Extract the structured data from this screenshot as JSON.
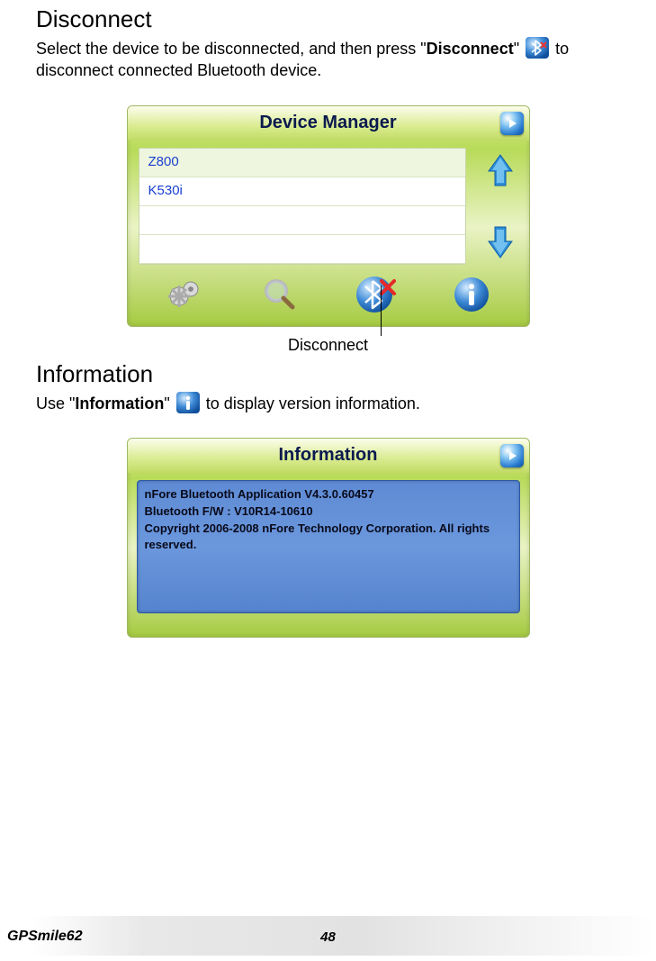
{
  "section_disconnect": {
    "heading": "Disconnect",
    "text_pre": "Select the device to be disconnected, and then press \"",
    "text_bold": "Disconnect",
    "text_mid": "\" ",
    "text_post": " to disconnect connected Bluetooth device."
  },
  "device_manager": {
    "title": "Device Manager",
    "devices": [
      "Z800",
      "K530i",
      "",
      ""
    ]
  },
  "disconnect_callout": "Disconnect",
  "section_info": {
    "heading": "Information",
    "text_pre": "Use \"",
    "text_bold": "Information",
    "text_mid": "\" ",
    "text_post": " to display version information."
  },
  "information_panel": {
    "title": "Information",
    "line1": "nFore Bluetooth Application V4.3.0.60457",
    "line2": "Bluetooth F/W : V10R14-10610",
    "line3": "Copyright 2006-2008 nFore Technology Corporation. All rights reserved."
  },
  "footer": {
    "product": "GPSmile62",
    "page": "48"
  }
}
